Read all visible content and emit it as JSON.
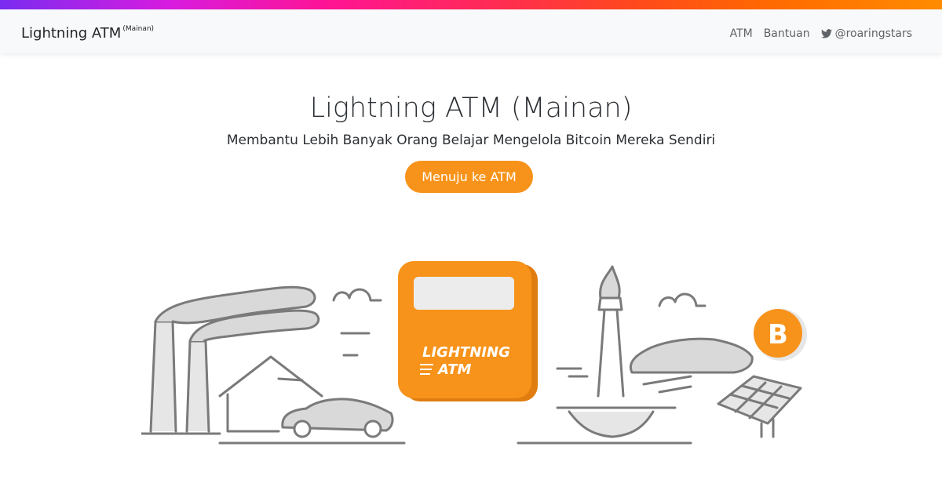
{
  "navbar": {
    "brand": "Lightning ATM",
    "brand_sup": "(Mainan)",
    "links": [
      {
        "label": "ATM"
      },
      {
        "label": "Bantuan"
      },
      {
        "label": "@roaringstars",
        "icon": "twitter-icon"
      }
    ]
  },
  "hero": {
    "title": "Lightning ATM (Mainan)",
    "subtitle": "Membantu Lebih Banyak Orang Belajar Mengelola Bitcoin Mereka Sendiri",
    "cta_label": "Menuju ke ATM"
  },
  "illustration": {
    "atm_line1": "LIGHTNING",
    "atm_line2": "ATM",
    "bitcoin_symbol": "B"
  },
  "colors": {
    "accent": "#f7931a",
    "atm_orange": "#f7931a",
    "atm_shadow": "#e07d10",
    "line_gray": "#7a7a7a",
    "fill_gray": "#d9d9d9"
  }
}
